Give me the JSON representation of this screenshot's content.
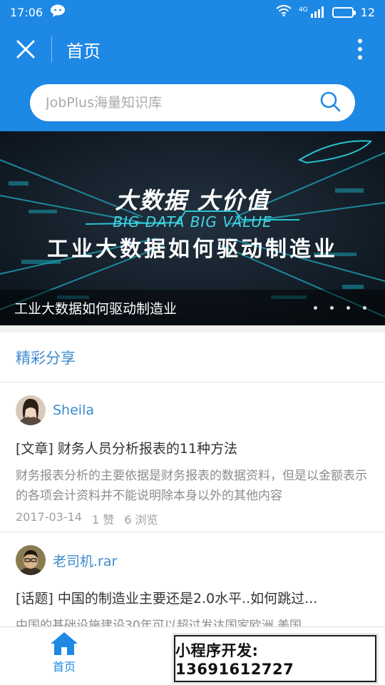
{
  "status_bar": {
    "time": "17:06",
    "network": "4G",
    "battery": "12",
    "icons": [
      "wechat-icon",
      "wifi-icon",
      "signal-icon",
      "battery-icon"
    ]
  },
  "title_bar": {
    "title": "首页",
    "close_icon": "close-icon",
    "more_icon": "more-vertical-icon"
  },
  "search": {
    "placeholder": "JobPlus海量知识库",
    "icon": "search-icon"
  },
  "banner": {
    "headline": "大数据 大价值",
    "english": "BIG DATA BIG VALUE",
    "subheadline": "工业大数据如何驱动制造业",
    "caption": "工业大数据如何驱动制造业",
    "slide_count": 4
  },
  "section": {
    "title": "精彩分享"
  },
  "posts": [
    {
      "author": "Sheila",
      "title": "[文章] 财务人员分析报表的11种方法",
      "excerpt": "财务报表分析的主要依据是财务报表的数据资料，但是以金额表示的各项会计资料并不能说明除本身以外的其他内容",
      "date": "2017-03-14",
      "likes": "1 赞",
      "views": "6 浏览"
    },
    {
      "author": "老司机.rar",
      "title": "[话题] 中国的制造业主要还是2.0水平..如何跳过...",
      "excerpt": "中国的基础设施建设30年可以超过发达国家欧洲,美国"
    }
  ],
  "tab_bar": {
    "home_label": "首页",
    "home_icon": "home-icon"
  },
  "promo": {
    "text": "小程序开发: 13691612727"
  },
  "colors": {
    "primary": "#1e88e5",
    "link": "#3d8ad0",
    "text": "#333333",
    "muted": "#8c8c8c"
  }
}
